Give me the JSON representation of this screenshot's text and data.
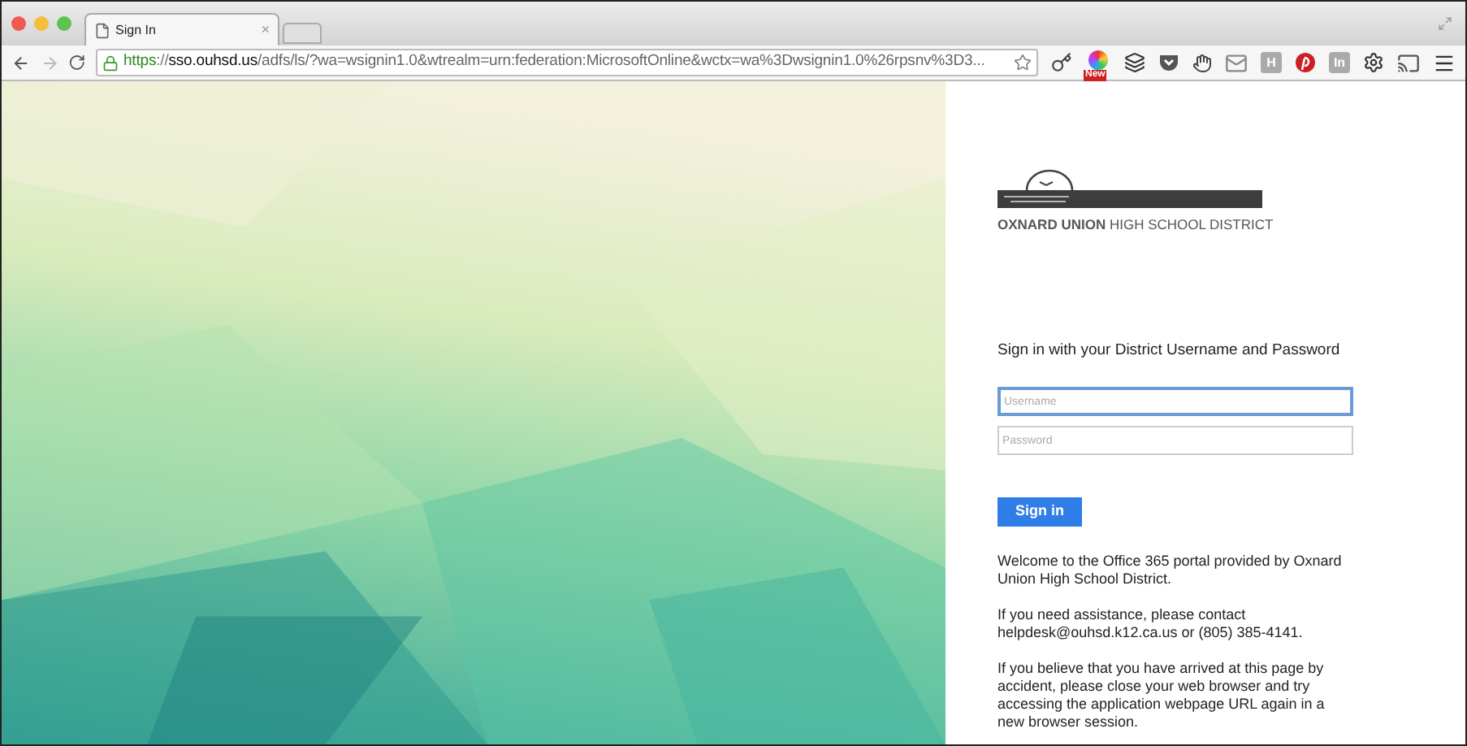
{
  "tab": {
    "title": "Sign In",
    "close": "×"
  },
  "address": {
    "scheme": "https",
    "separator": "://",
    "host": "sso.ouhsd.us",
    "path": "/adfs/ls/?wa=wsignin1.0&wtrealm=urn:federation:MicrosoftOnline&wctx=wa%3Dwsignin1.0%26rpsnv%3D3..."
  },
  "extensions": [
    {
      "kind": "key"
    },
    {
      "kind": "badge",
      "label": "New"
    },
    {
      "kind": "layers"
    },
    {
      "kind": "pocket"
    },
    {
      "kind": "hand"
    },
    {
      "kind": "mail"
    },
    {
      "kind": "letter",
      "label": "H"
    },
    {
      "kind": "pinterest"
    },
    {
      "kind": "letter",
      "label": "In"
    },
    {
      "kind": "gear"
    },
    {
      "kind": "cast"
    },
    {
      "kind": "menu"
    }
  ],
  "logo": {
    "text": "**OXNARD UNION** HIGH SCHOOL DISTRICT"
  },
  "form": {
    "heading": "Sign in with your District Username and Password",
    "fields": [
      {
        "placeholder": "Username",
        "focused": true
      },
      {
        "placeholder": "Password",
        "focused": false
      }
    ],
    "submit": "Sign in"
  },
  "messages": [
    "Welcome to the Office 365 portal provided by Oxnard Union High School District.",
    "If you need assistance, please contact helpdesk@ouhsd.k12.ca.us or (805) 385-4141.",
    "If you believe that you have arrived at this page by accident, please close your web browser and try accessing the application webpage URL again in a new browser session."
  ]
}
